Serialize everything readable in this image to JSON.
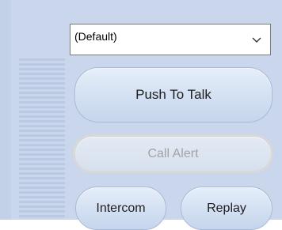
{
  "device_select": {
    "value": "(Default)",
    "chevron_icon": "chevron-down-icon"
  },
  "buttons": {
    "push_to_talk": "Push To Talk",
    "call_alert": "Call Alert",
    "intercom": "Intercom",
    "replay": "Replay"
  },
  "states": {
    "call_alert_disabled": true
  },
  "colors": {
    "panel_bg": "#c9d6eb",
    "button_bg": "#d3e0f2",
    "disabled_text": "#a3a3a3"
  }
}
